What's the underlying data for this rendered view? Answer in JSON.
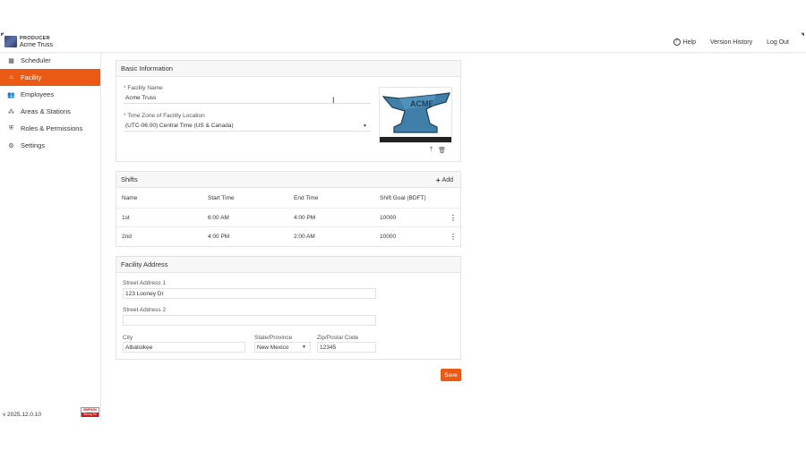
{
  "header": {
    "product": "PRODUCER",
    "company": "Acme Truss",
    "nav": {
      "help": "Help",
      "version_history": "Version History",
      "logout": "Log Out"
    }
  },
  "sidebar": {
    "items": [
      {
        "label": "Scheduler",
        "icon": "list-icon"
      },
      {
        "label": "Facility",
        "icon": "home-icon",
        "active": true
      },
      {
        "label": "Employees",
        "icon": "people-icon"
      },
      {
        "label": "Areas & Stations",
        "icon": "group-icon"
      },
      {
        "label": "Roles & Permissions",
        "icon": "shield-icon"
      },
      {
        "label": "Settings",
        "icon": "gear-icon"
      }
    ],
    "version": "v 2025.12.0.10",
    "footer_logo_top": "SIMPSON",
    "footer_logo_bottom": "Strong-Tie"
  },
  "basic_info": {
    "title": "Basic Information",
    "facility_name_label": "Facility Name",
    "facility_name_value": "Acme Truss",
    "timezone_label": "Time Zone of Facility Location",
    "timezone_value": "(UTC-06:00) Central Time (US & Canada)",
    "logo_text": "ACME"
  },
  "shifts": {
    "title": "Shifts",
    "add_label": "Add",
    "columns": [
      "Name",
      "Start Time",
      "End Time",
      "Shift Goal (BDFT)"
    ],
    "rows": [
      [
        "1st",
        "6:00 AM",
        "4:00 PM",
        "10000"
      ],
      [
        "2nd",
        "4:00 PM",
        "2:00 AM",
        "10000"
      ]
    ]
  },
  "address": {
    "title": "Facility Address",
    "street1_label": "Street Address 1",
    "street1_value": "123 Looney Dr",
    "street2_label": "Street Address 2",
    "street2_value": "",
    "city_label": "City",
    "city_value": "Albatoikee",
    "state_label": "State/Province",
    "state_value": "New Mexico",
    "zip_label": "Zip/Postal Code",
    "zip_value": "12345"
  },
  "save_label": "Save",
  "colors": {
    "accent": "#ea5a14",
    "anvil": "#3f7fa8"
  }
}
